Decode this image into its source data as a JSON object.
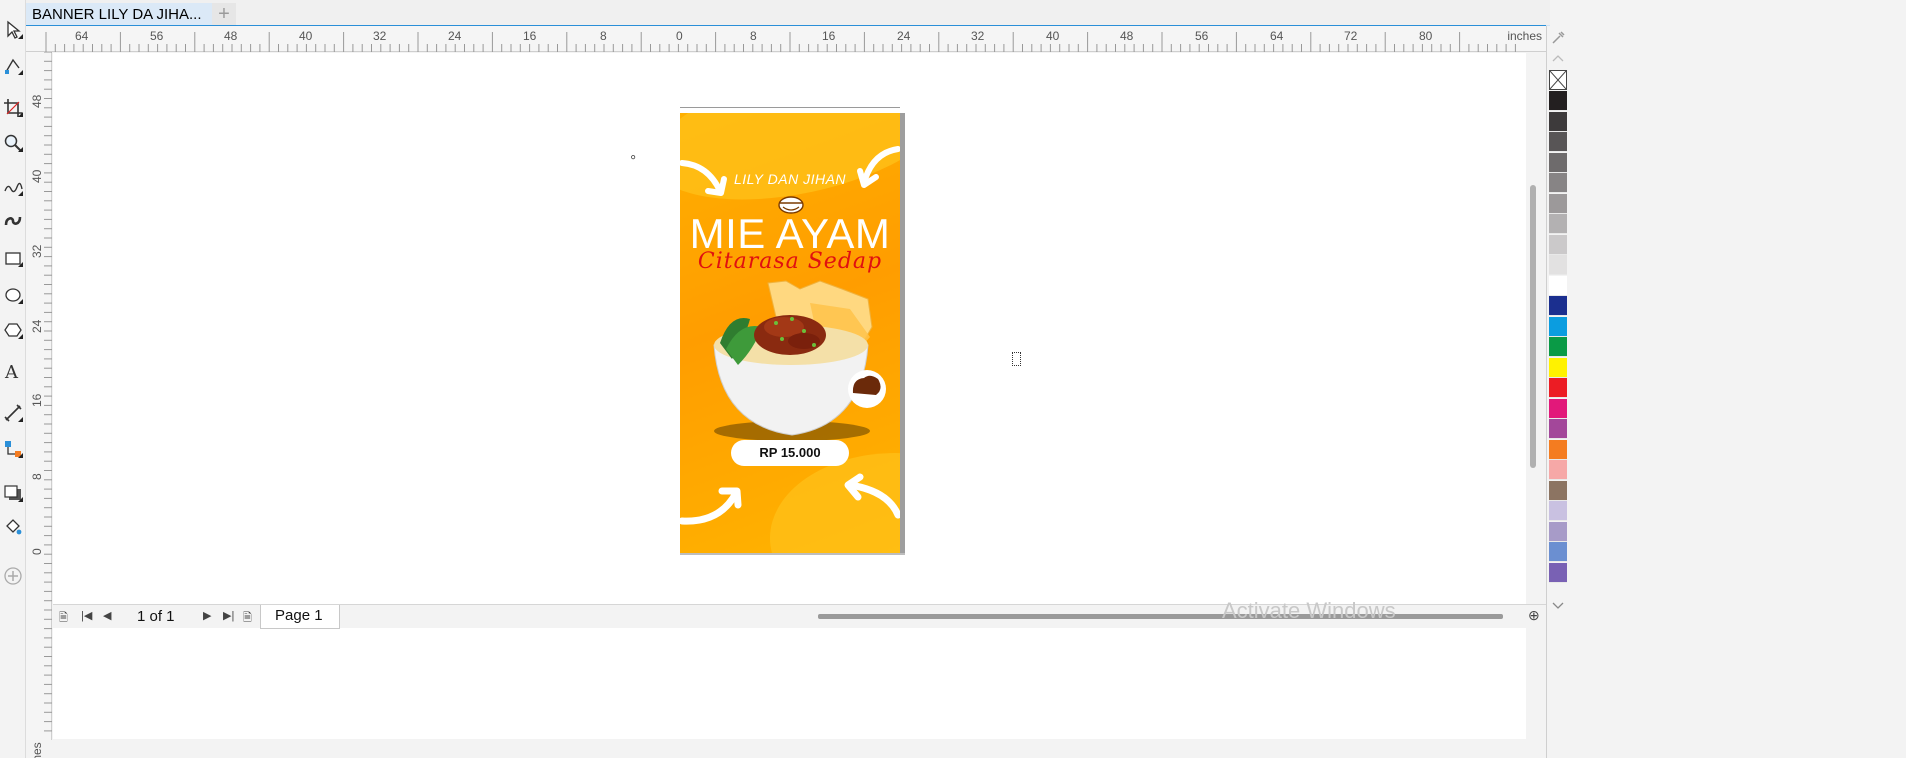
{
  "document_tab": {
    "title": "BANNER LILY DA JIHA..."
  },
  "ruler": {
    "units": "inches",
    "h_ticks": [
      "64",
      "56",
      "48",
      "40",
      "32",
      "24",
      "16",
      "8",
      "0",
      "8",
      "16",
      "24",
      "32",
      "40",
      "48",
      "56",
      "64",
      "72",
      "80"
    ],
    "v_ticks": [
      "48",
      "40",
      "32",
      "24",
      "16",
      "8",
      "0"
    ]
  },
  "banner": {
    "brand": "LILY DAN JIHAN",
    "title": "MIE AYAM",
    "tagline": "Citarasa Sedap",
    "price": "RP 15.000"
  },
  "statusbar": {
    "page_count": "1 of 1",
    "page_tab": "Page 1"
  },
  "watermark": "Activate Windows",
  "palette": {
    "swatches": [
      "#231f20",
      "#3d3a3b",
      "#585556",
      "#6e6b6c",
      "#878485",
      "#9c999a",
      "#b3b1b2",
      "#cbc9ca",
      "#e2e1e1",
      "#ffffff",
      "#1b2f8f",
      "#0b9de0",
      "#0a9a46",
      "#fff200",
      "#ec1c24",
      "#e2187a",
      "#a3479a",
      "#f47c20",
      "#f6a8a7",
      "#8c7462",
      "#c9c1e1",
      "#a79bc8",
      "#6b8fd1",
      "#7961b4"
    ]
  }
}
